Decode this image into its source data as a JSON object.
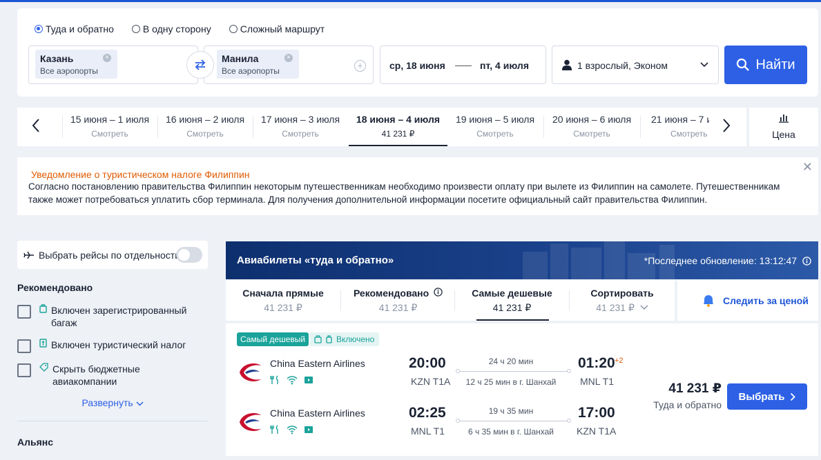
{
  "search": {
    "trip_types": [
      "Туда и обратно",
      "В одну сторону",
      "Сложный маршрут"
    ],
    "trip_selected": 0,
    "from_city": "Казань",
    "from_airports": "Все аэропорты",
    "to_city": "Манила",
    "to_airports": "Все аэропорты",
    "date_from": "ср, 18 июня",
    "date_to": "пт, 4 июля",
    "passengers": "1 взрослый, Эконом",
    "search_button": "Найти",
    "accent_color": "#2d60e5"
  },
  "date_tabs": [
    {
      "label": "15 июня – 1 июля",
      "sub": "Смотреть"
    },
    {
      "label": "16 июня – 2 июля",
      "sub": "Смотреть"
    },
    {
      "label": "17 июня – 3 июля",
      "sub": "Смотреть"
    },
    {
      "label": "18 июня – 4 июля",
      "sub": "41 231 ₽",
      "active": true
    },
    {
      "label": "19 июня – 5 июля",
      "sub": "Смотреть"
    },
    {
      "label": "20 июня – 6 июля",
      "sub": "Смотреть"
    },
    {
      "label": "21 июня – 7 июля",
      "sub": "Смотреть"
    }
  ],
  "price_chart_label": "Цена",
  "notice": {
    "title": "Уведомление о туристическом налоге Филиппин",
    "body": "Согласно постановлению правительства Филиппин некоторым путешественникам необходимо произвести оплату при вылете из Филиппин на самолете. Путешественникам также может потребоваться уплатить сбор терминала. Для получения дополнительной информации посетите официальный сайт правительства Филиппин."
  },
  "sidebar": {
    "separate_flights": "Выбрать рейсы по отдельности",
    "recommended_heading": "Рекомендовано",
    "filters": [
      {
        "label": "Включен зарегистрированный багаж",
        "icon": "luggage-icon"
      },
      {
        "label": "Включен туристический налог",
        "icon": "tax-icon"
      },
      {
        "label": "Скрыть бюджетные авиакомпании",
        "icon": "tag-icon"
      }
    ],
    "expand": "Развернуть",
    "alliance_heading": "Альянс"
  },
  "results": {
    "title": "Авиабилеты «туда и обратно»",
    "last_update": "*Последнее обновление: 13:12:47",
    "sort_options": [
      {
        "label": "Сначала прямые",
        "price": "41 231 ₽"
      },
      {
        "label": "Рекомендовано",
        "price": "41 231 ₽"
      },
      {
        "label": "Самые дешевые",
        "price": "41 231 ₽",
        "active": true
      },
      {
        "label": "Сортировать",
        "price": "41 231 ₽"
      }
    ],
    "watch_price": "Следить за ценой"
  },
  "ticket": {
    "badge_cheapest": "Самый дешевый",
    "badge_included": "Включено",
    "price": "41 231 ₽",
    "price_note": "Туда и обратно",
    "choose_button": "Выбрать",
    "legs": [
      {
        "airline": "China Eastern Airlines",
        "dep_time": "20:00",
        "dep_code": "KZN T1A",
        "duration": "24 ч 20 мин",
        "stopover": "12 ч 25 мин в г. Шанхай",
        "arr_time": "01:20",
        "arr_plus": "+2",
        "arr_code": "MNL T1"
      },
      {
        "airline": "China Eastern Airlines",
        "dep_time": "02:25",
        "dep_code": "MNL T1",
        "duration": "19 ч 35 мин",
        "stopover": "6 ч 35 мин в г. Шанхай",
        "arr_time": "17:00",
        "arr_plus": "",
        "arr_code": "KZN T1A"
      }
    ]
  }
}
